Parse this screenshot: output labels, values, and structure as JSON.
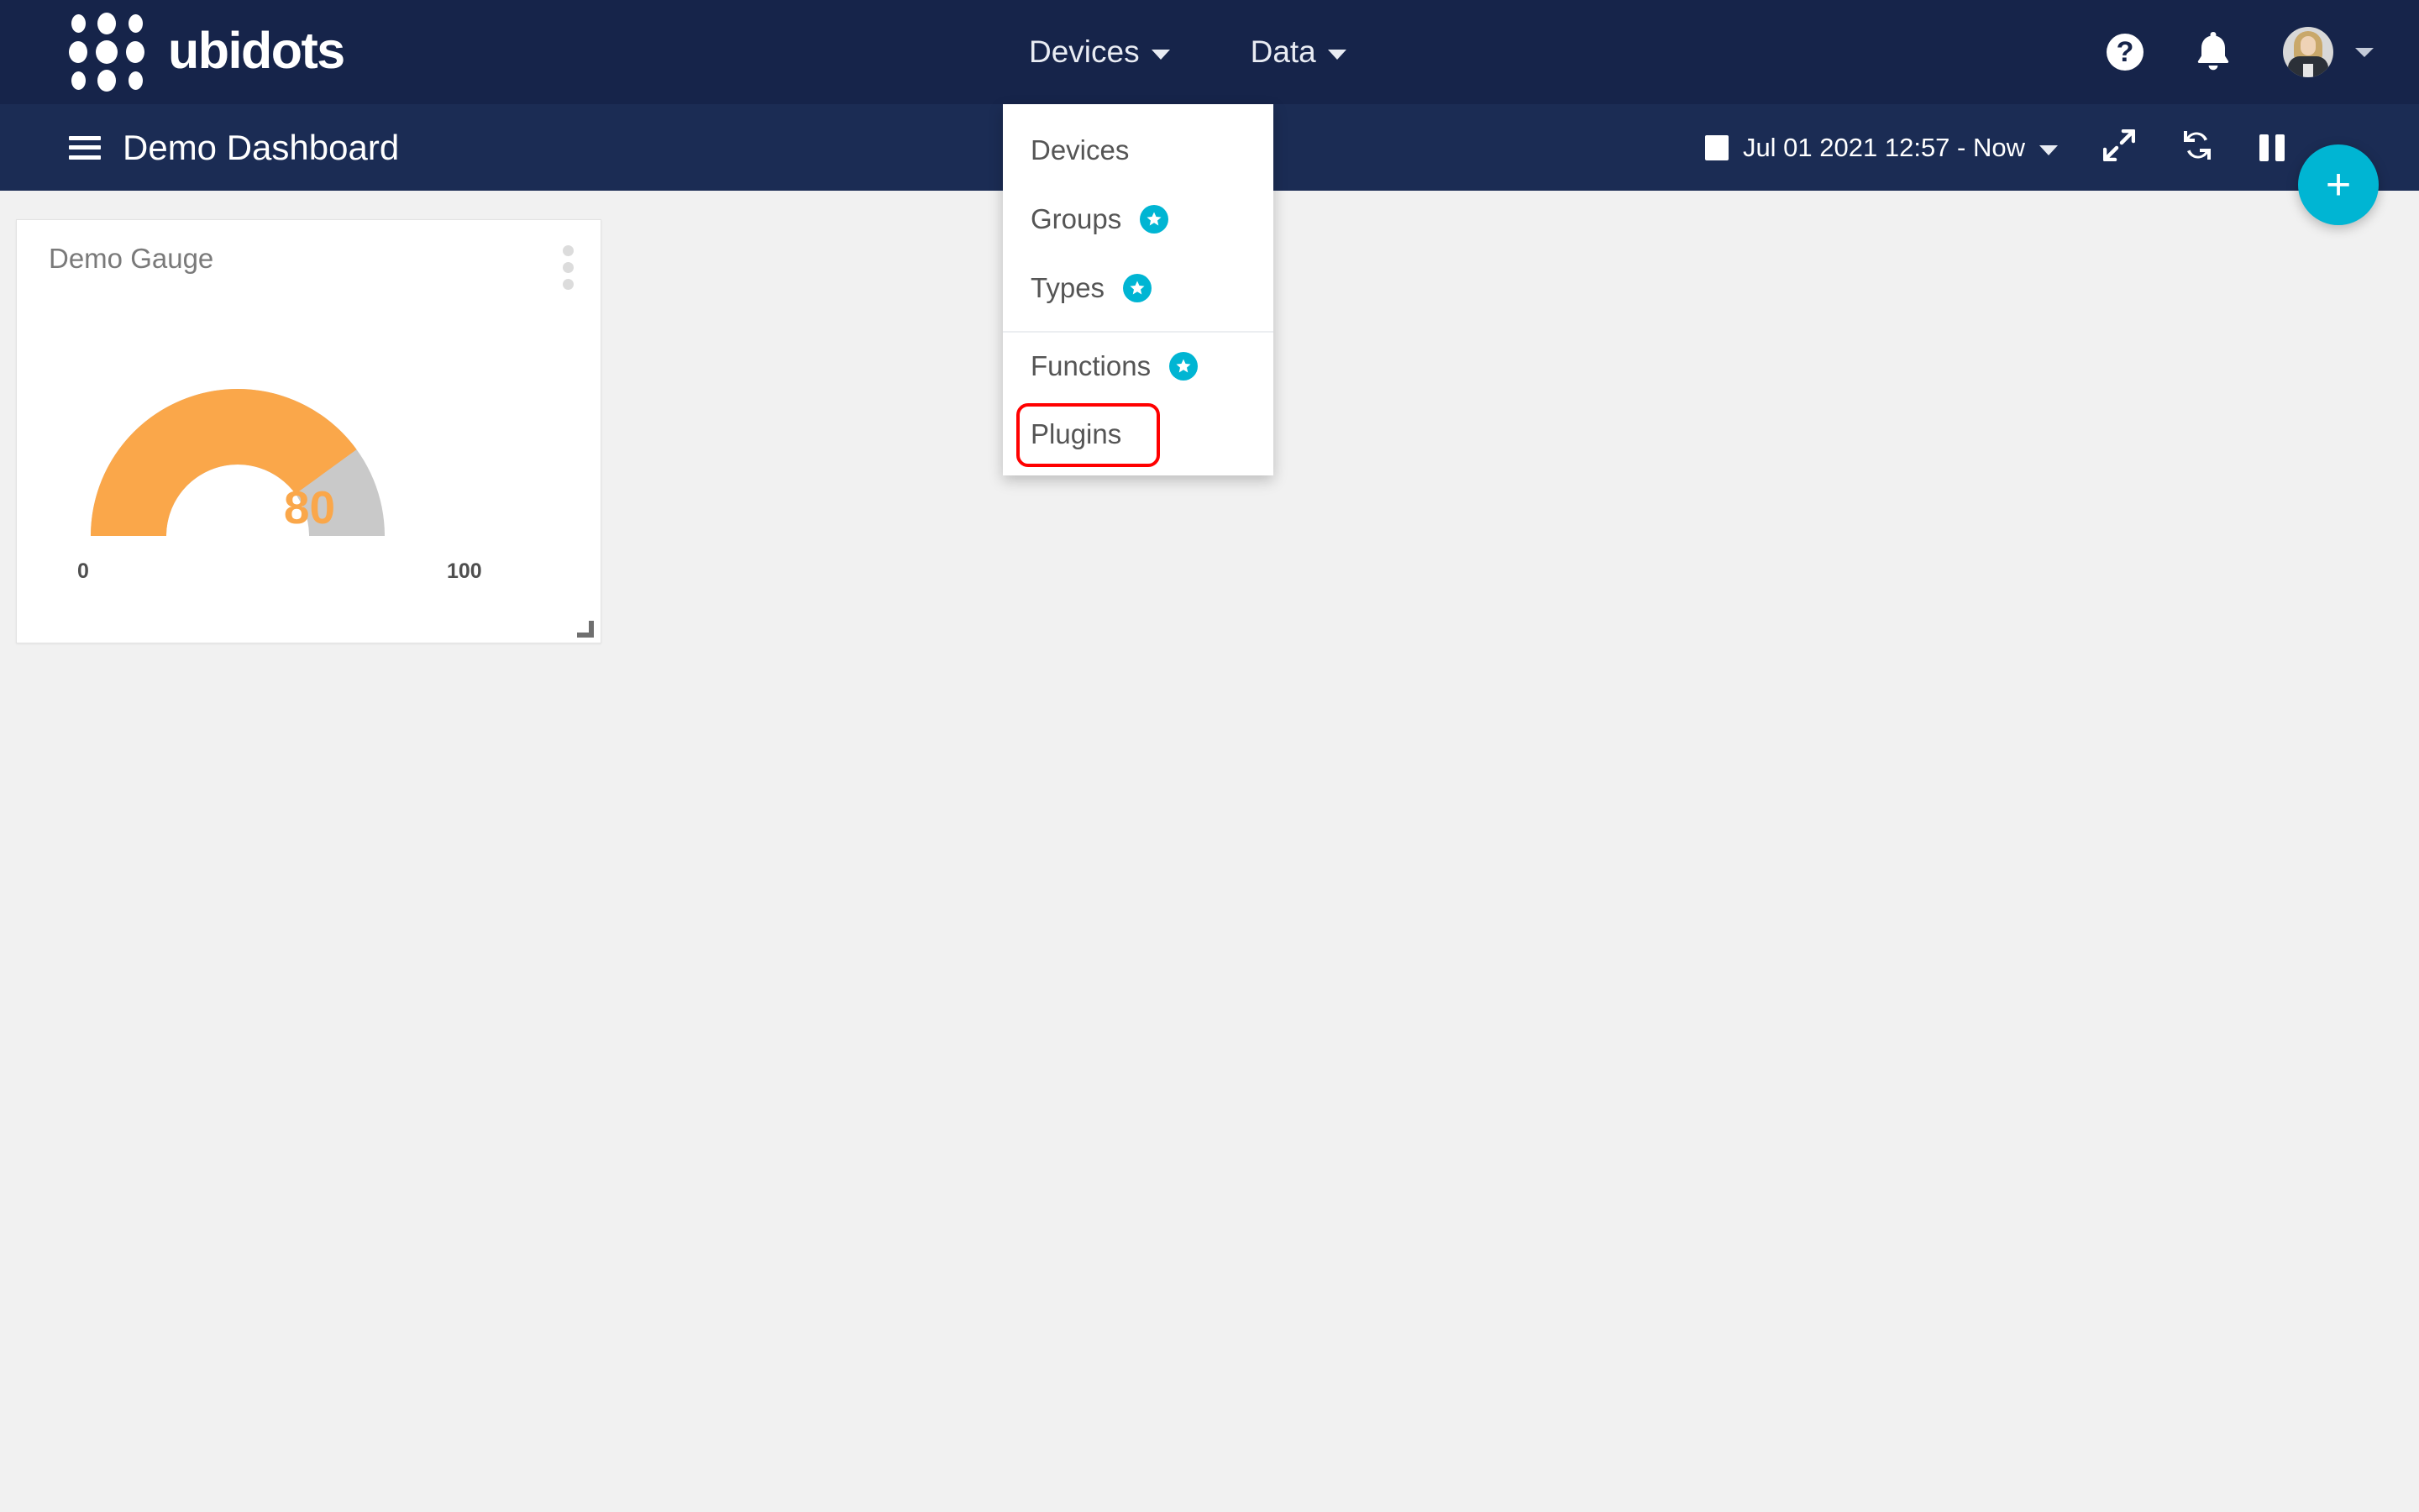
{
  "brand": {
    "name": "ubidots",
    "logo_icon": "ubidots-dots-logo"
  },
  "navbar": {
    "links": [
      {
        "label": "Devices",
        "icon": "chevron-down-icon"
      },
      {
        "label": "Data",
        "icon": "chevron-down-icon"
      }
    ],
    "help_icon_label": "?",
    "bell_icon": "bell-icon",
    "avatar_icon": "user-avatar",
    "account_caret_icon": "chevron-down-icon"
  },
  "devices_menu": {
    "items": [
      {
        "label": "Devices",
        "badge": false,
        "separator_before": false,
        "highlighted": false
      },
      {
        "label": "Groups",
        "badge": true,
        "separator_before": false,
        "highlighted": false
      },
      {
        "label": "Types",
        "badge": true,
        "separator_before": false,
        "highlighted": false
      },
      {
        "label": "Functions",
        "badge": true,
        "separator_before": true,
        "highlighted": false
      },
      {
        "label": "Plugins",
        "badge": false,
        "separator_before": false,
        "highlighted": true
      }
    ],
    "badge_icon": "star-icon",
    "highlight_color": "#ff0000"
  },
  "subheader": {
    "menu_icon": "hamburger-icon",
    "title": "Demo Dashboard",
    "date_range": "Jul 01 2021 12:57 - Now",
    "calendar_icon": "calendar-icon",
    "date_caret_icon": "chevron-down-icon",
    "expand_icon": "expand-arrows-icon",
    "refresh_icon": "refresh-icon",
    "pause_icon": "pause-icon"
  },
  "fab": {
    "label": "+",
    "icon": "plus-icon",
    "color": "#00b5d3"
  },
  "widget": {
    "title": "Demo Gauge",
    "menu_icon": "kebab-menu-icon",
    "resize_icon": "resize-handle-icon"
  },
  "chart_data": {
    "type": "gauge",
    "title": "Demo Gauge",
    "value": 80,
    "value_label": "80",
    "min": 0,
    "max": 100,
    "min_label": "0",
    "max_label": "100",
    "tick_labels": [
      "0",
      "100"
    ],
    "unit": "",
    "arc_start_angle": 180,
    "arc_end_angle": 360,
    "filled_fraction": 0.8,
    "colors": {
      "filled": "#faa74a",
      "track": "#c9c9c9",
      "value_text": "#faa74a"
    },
    "xlabel": "",
    "ylabel": "",
    "legend": []
  },
  "theme": {
    "navbar_bg": "#16244a",
    "subheader_bg": "#1b2c54",
    "page_bg": "#f1f1f1",
    "accent": "#00b5d3",
    "gauge_orange": "#faa74a"
  }
}
